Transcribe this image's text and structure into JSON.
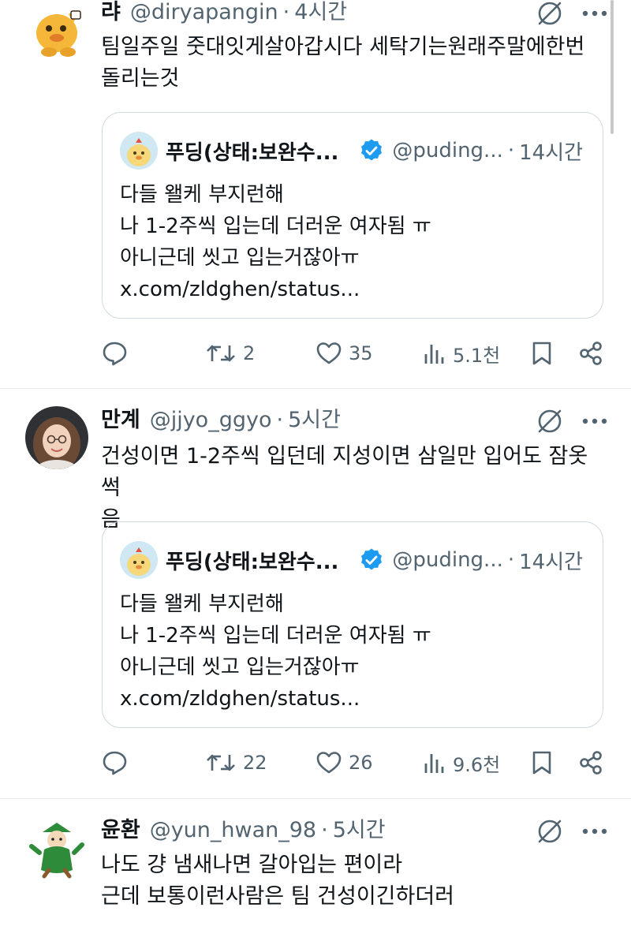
{
  "tweets": [
    {
      "name": "랴",
      "handle": "@diryapangin",
      "dot": "·",
      "time": "4시간",
      "text": "팀일주일 줏대잇게살아갑시다 세탁기는원래주말에한번\n돌리는것",
      "quote": {
        "name": "푸딩(상태:보완수...",
        "handle": "@puding...",
        "dot": "·",
        "time": "14시간",
        "lines": [
          "다들 왤케 부지런해",
          "나 1-2주씩 입는데 더러운 여자됨 ㅠ",
          "아니근데 씻고 입는거잖아ㅠ",
          "x.com/zldghen/status..."
        ]
      },
      "actions": {
        "retweets": "2",
        "likes": "35",
        "views": "5.1천"
      }
    },
    {
      "name": "만계",
      "handle": "@jjyo_ggyo",
      "dot": "·",
      "time": "5시간",
      "text": "건성이면 1-2주씩 입던데 지성이면 삼일만 입어도 잠옷썩\n음",
      "quote": {
        "name": "푸딩(상태:보완수...",
        "handle": "@puding...",
        "dot": "·",
        "time": "14시간",
        "lines": [
          "다들 왤케 부지런해",
          "나 1-2주씩 입는데 더러운 여자됨 ㅠ",
          "아니근데 씻고 입는거잖아ㅠ",
          "x.com/zldghen/status..."
        ]
      },
      "actions": {
        "retweets": "22",
        "likes": "26",
        "views": "9.6천"
      }
    },
    {
      "name": "윤환",
      "handle": "@yun_hwan_98",
      "dot": "·",
      "time": "5시간",
      "text": "나도 걍 냄새나면 갈아입는 편이라\n근데 보통이런사람은 팀 건성이긴하더러"
    }
  ],
  "icons": {
    "more": "more-horizontal-icon",
    "grok": "grok-icon",
    "reply": "reply-icon",
    "retweet": "retweet-icon",
    "like": "heart-icon",
    "views": "views-icon",
    "bookmark": "bookmark-icon",
    "share": "share-icon",
    "verified": "verified-badge-icon"
  },
  "colors": {
    "text": "#0f1419",
    "secondary": "#536471",
    "border": "#cfd9de",
    "verified": "#1d9bf0"
  }
}
